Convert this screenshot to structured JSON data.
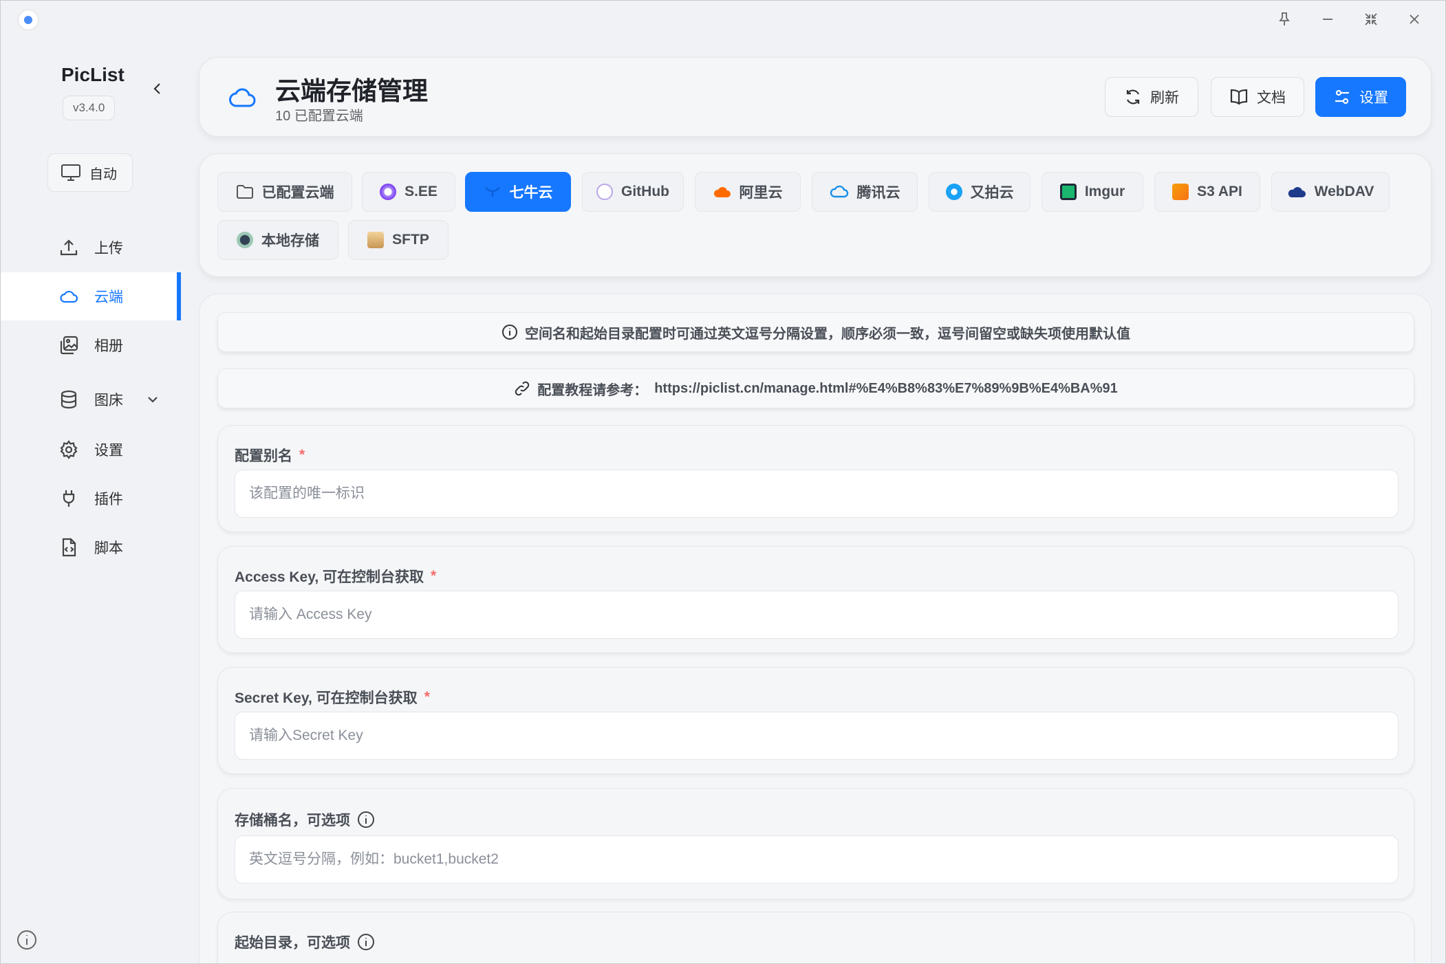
{
  "app": {
    "name": "PicList",
    "version": "v3.4.0"
  },
  "sidebar": {
    "auto_label": "自动",
    "items": [
      {
        "label": "上传",
        "icon": "upload-icon"
      },
      {
        "label": "云端",
        "icon": "cloud-icon",
        "active": true
      },
      {
        "label": "相册",
        "icon": "gallery-icon"
      },
      {
        "label": "图床",
        "icon": "database-icon"
      },
      {
        "label": "设置",
        "icon": "gear-icon"
      },
      {
        "label": "插件",
        "icon": "plug-icon"
      },
      {
        "label": "脚本",
        "icon": "script-icon"
      }
    ]
  },
  "header": {
    "title": "云端存储管理",
    "subtitle": "10 已配置云端",
    "refresh_label": "刷新",
    "docs_label": "文档",
    "settings_label": "设置"
  },
  "tabs": [
    {
      "label": "已配置云端"
    },
    {
      "label": "S.EE"
    },
    {
      "label": "七牛云",
      "active": true
    },
    {
      "label": "GitHub"
    },
    {
      "label": "阿里云"
    },
    {
      "label": "腾讯云"
    },
    {
      "label": "又拍云"
    },
    {
      "label": "Imgur"
    },
    {
      "label": "S3 API"
    },
    {
      "label": "WebDAV"
    },
    {
      "label": "本地存储"
    },
    {
      "label": "SFTP"
    }
  ],
  "notices": {
    "hint": "空间名和起始目录配置时可通过英文逗号分隔设置，顺序必须一致，逗号间留空或缺失项使用默认值",
    "tutorial_prefix": "配置教程请参考：",
    "tutorial_url": "https://piclist.cn/manage.html#%E4%B8%83%E7%89%9B%E4%BA%91"
  },
  "form": {
    "alias": {
      "label": "配置别名",
      "placeholder": "该配置的唯一标识",
      "value": ""
    },
    "access_key": {
      "label": "Access Key, 可在控制台获取",
      "placeholder": "请输入 Access Key",
      "value": ""
    },
    "secret_key": {
      "label": "Secret Key, 可在控制台获取",
      "placeholder": "请输入Secret Key",
      "value": ""
    },
    "bucket": {
      "label": "存储桶名，可选项",
      "placeholder": "英文逗号分隔，例如：bucket1,bucket2",
      "value": ""
    },
    "base_dir": {
      "label": "起始目录，可选项"
    }
  },
  "colors": {
    "accent": "#1677ff",
    "required": "#f56c6c"
  }
}
